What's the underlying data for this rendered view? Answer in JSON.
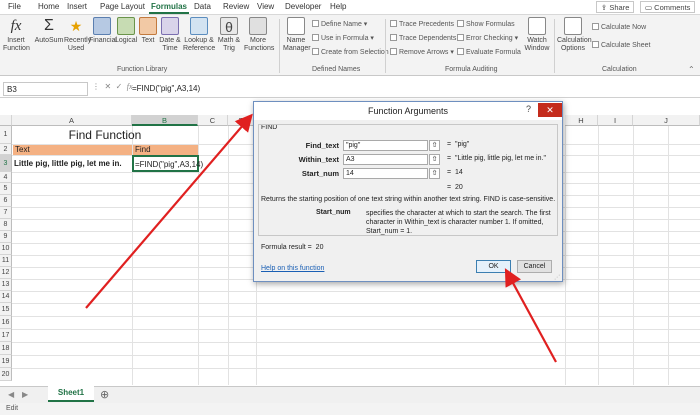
{
  "ribbon_tabs": [
    "File",
    "Home",
    "Insert",
    "Page Layout",
    "Formulas",
    "Data",
    "Review",
    "View",
    "Developer",
    "Help"
  ],
  "active_tab": "Formulas",
  "share_label": "Share",
  "comments_label": "Comments",
  "ribbon": {
    "insert_function": "Insert Function",
    "autosum": "AutoSum",
    "recently_used": "Recently Used",
    "financial": "Financial",
    "logical": "Logical",
    "text": "Text",
    "date_time": "Date & Time",
    "lookup_reference": "Lookup & Reference",
    "math_trig": "Math & Trig",
    "more_functions": "More Functions",
    "function_library": "Function Library",
    "name_manager": "Name Manager",
    "define_name": "Define Name",
    "use_in_formula": "Use in Formula",
    "create_from_selection": "Create from Selection",
    "defined_names": "Defined Names",
    "trace_precedents": "Trace Precedents",
    "trace_dependents": "Trace Dependents",
    "remove_arrows": "Remove Arrows",
    "show_formulas": "Show Formulas",
    "error_checking": "Error Checking",
    "evaluate_formula": "Evaluate Formula",
    "watch_window": "Watch Window",
    "formula_auditing": "Formula Auditing",
    "calculation_options": "Calculation Options",
    "calculate_now": "Calculate Now",
    "calculate_sheet": "Calculate Sheet",
    "calculation": "Calculation"
  },
  "name_box": "B3",
  "formula": "=FIND(\"pig\",A3,14)",
  "columns": [
    "A",
    "B",
    "C",
    "D",
    "E",
    "F",
    "G",
    "H",
    "I",
    "J"
  ],
  "rows": [
    "1",
    "2",
    "3",
    "4",
    "5",
    "6",
    "7",
    "8",
    "9",
    "10",
    "11",
    "12",
    "13",
    "14",
    "15",
    "16",
    "17",
    "18",
    "19",
    "20"
  ],
  "cells": {
    "title": "Find Function",
    "a2": "Text",
    "b2": "Find",
    "a3": "Little pig, little pig, let me in.",
    "b3": "=FIND(\"pig\",A3,14)"
  },
  "sheet_tab": "Sheet1",
  "status": "Edit",
  "dialog": {
    "title": "Function Arguments",
    "function_name": "FIND",
    "args": [
      {
        "label": "Find_text",
        "value": "\"pig\"",
        "result": "\"pig\""
      },
      {
        "label": "Within_text",
        "value": "A3",
        "result": "\"Little pig, little pig, let me in.\""
      },
      {
        "label": "Start_num",
        "value": "14",
        "result": "14"
      }
    ],
    "total_result": "20",
    "description": "Returns the starting position of one text string within another text string. FIND is case-sensitive.",
    "arg_help_name": "Start_num",
    "arg_help_text": "specifies the character at which to start the search. The first character in Within_text is character number 1. If omitted, Start_num = 1.",
    "formula_result_label": "Formula result =",
    "formula_result_value": "20",
    "help_link": "Help on this function",
    "ok": "OK",
    "cancel": "Cancel"
  },
  "colors": {
    "accent": "#217346",
    "header_fill": "#f4b183",
    "arrow": "#e02020"
  }
}
